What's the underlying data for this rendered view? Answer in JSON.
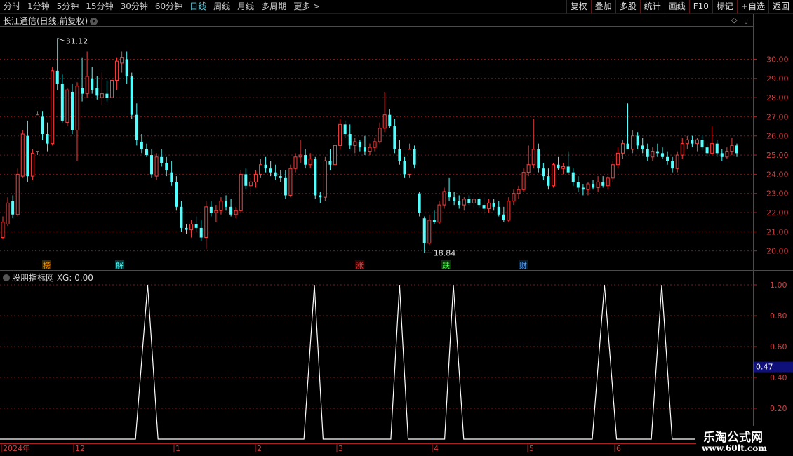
{
  "toolbar": {
    "periods": [
      "分时",
      "1分钟",
      "5分钟",
      "15分钟",
      "30分钟",
      "60分钟",
      "日线",
      "周线",
      "月线",
      "多周期",
      "更多 >"
    ],
    "active_period": "日线",
    "buttons": [
      "复权",
      "叠加",
      "多股",
      "统计",
      "画线",
      "F10",
      "标记",
      "+自选",
      "返回"
    ]
  },
  "stock_title": "长江通信(日线,前复权)",
  "indicator_title": "股朋指标网 XG: 0.00",
  "colors": {
    "up": "#ff3c3c",
    "down": "#54ffff",
    "grid": "#7a1a1a",
    "axis": "#b02020",
    "signal": "#ffffff"
  },
  "price_axis": {
    "min": 19.0,
    "max": 31.7,
    "ticks": [
      "20.00",
      "21.00",
      "22.00",
      "23.00",
      "24.00",
      "25.00",
      "26.00",
      "27.00",
      "28.00",
      "29.00",
      "30.00"
    ]
  },
  "annotations": {
    "high": "31.12",
    "low": "18.84"
  },
  "event_markers": [
    {
      "label": "榜",
      "color": "#ff9900",
      "bg": "#3a2a00"
    },
    {
      "label": "解",
      "color": "#54ffff",
      "bg": "#003a3a"
    },
    {
      "label": "涨",
      "color": "#ff3c3c",
      "bg": "#3a0000"
    },
    {
      "label": "跌",
      "color": "#40ff40",
      "bg": "#003a00"
    },
    {
      "label": "财",
      "color": "#5aa0ff",
      "bg": "#00203a"
    }
  ],
  "indicator_axis": {
    "ticks": [
      "1.00",
      "0.80",
      "0.60",
      "0.40",
      "0.20"
    ],
    "current": "0.47"
  },
  "time_axis": [
    "2024年",
    "12",
    "1",
    "2",
    "3",
    "4",
    "5",
    "6"
  ],
  "watermark": {
    "line1": "乐淘公式网",
    "line2": "www.60lt.com"
  },
  "chart_data": {
    "type": "candlestick",
    "ohlc": [
      [
        20.7,
        21.8,
        20.6,
        21.5
      ],
      [
        21.4,
        22.8,
        21.3,
        22.5
      ],
      [
        22.6,
        22.9,
        21.7,
        21.9
      ],
      [
        21.9,
        24.3,
        21.8,
        24.0
      ],
      [
        23.9,
        26.3,
        23.8,
        26.1
      ],
      [
        26.0,
        26.8,
        23.6,
        23.9
      ],
      [
        23.9,
        25.3,
        23.7,
        25.1
      ],
      [
        25.2,
        27.3,
        25.0,
        27.1
      ],
      [
        27.0,
        27.3,
        25.8,
        26.1
      ],
      [
        26.1,
        26.7,
        25.2,
        25.6
      ],
      [
        25.6,
        29.6,
        25.5,
        29.4
      ],
      [
        29.4,
        31.1,
        28.4,
        28.7
      ],
      [
        28.7,
        29.2,
        26.7,
        26.8
      ],
      [
        26.7,
        28.5,
        26.5,
        28.4
      ],
      [
        28.3,
        28.7,
        26.1,
        26.3
      ],
      [
        26.3,
        28.8,
        24.7,
        28.6
      ],
      [
        28.5,
        30.1,
        27.8,
        28.2
      ],
      [
        28.2,
        30.4,
        28.0,
        29.1
      ],
      [
        29.0,
        29.6,
        28.2,
        28.4
      ],
      [
        28.5,
        29.1,
        27.9,
        28.1
      ],
      [
        28.0,
        29.3,
        27.6,
        28.2
      ],
      [
        28.2,
        28.9,
        27.8,
        28.0
      ],
      [
        28.0,
        29.2,
        27.8,
        28.9
      ],
      [
        28.9,
        30.1,
        28.4,
        29.9
      ],
      [
        29.8,
        30.4,
        29.3,
        30.1
      ],
      [
        30.0,
        30.4,
        28.7,
        29.1
      ],
      [
        29.1,
        29.3,
        26.9,
        27.1
      ],
      [
        27.1,
        27.7,
        25.5,
        25.8
      ],
      [
        25.7,
        26.1,
        25.1,
        25.3
      ],
      [
        25.3,
        25.6,
        24.9,
        25.0
      ],
      [
        25.0,
        25.3,
        23.8,
        24.0
      ],
      [
        23.9,
        25.1,
        23.7,
        24.9
      ],
      [
        24.9,
        25.3,
        24.4,
        24.6
      ],
      [
        24.6,
        24.9,
        23.9,
        24.2
      ],
      [
        24.1,
        24.7,
        23.4,
        23.6
      ],
      [
        23.6,
        23.9,
        22.1,
        22.3
      ],
      [
        22.3,
        22.6,
        21.0,
        21.2
      ],
      [
        21.2,
        21.4,
        20.9,
        21.1
      ],
      [
        21.1,
        21.6,
        20.7,
        21.4
      ],
      [
        21.4,
        21.8,
        21.0,
        21.2
      ],
      [
        21.2,
        21.6,
        20.5,
        20.7
      ],
      [
        20.7,
        22.6,
        20.1,
        22.3
      ],
      [
        22.3,
        22.6,
        21.8,
        22.0
      ],
      [
        22.0,
        22.4,
        21.5,
        22.1
      ],
      [
        22.1,
        22.8,
        21.9,
        22.6
      ],
      [
        22.6,
        22.9,
        22.1,
        22.3
      ],
      [
        22.3,
        22.7,
        21.8,
        21.9
      ],
      [
        21.9,
        22.3,
        21.7,
        22.1
      ],
      [
        22.1,
        24.2,
        22.0,
        24.0
      ],
      [
        24.0,
        24.3,
        23.2,
        23.4
      ],
      [
        23.4,
        23.8,
        22.9,
        23.6
      ],
      [
        23.6,
        24.2,
        23.3,
        24.0
      ],
      [
        24.0,
        24.8,
        23.8,
        24.5
      ],
      [
        24.5,
        24.9,
        24.1,
        24.3
      ],
      [
        24.3,
        24.7,
        23.9,
        24.1
      ],
      [
        24.1,
        24.5,
        23.7,
        23.9
      ],
      [
        23.9,
        24.2,
        23.6,
        23.8
      ],
      [
        23.8,
        24.2,
        22.7,
        22.9
      ],
      [
        22.9,
        24.5,
        22.8,
        24.3
      ],
      [
        24.3,
        25.1,
        24.1,
        24.9
      ],
      [
        24.9,
        25.8,
        24.6,
        25.0
      ],
      [
        25.0,
        25.3,
        24.3,
        24.5
      ],
      [
        24.5,
        25.1,
        24.3,
        24.8
      ],
      [
        24.8,
        24.9,
        22.7,
        22.9
      ],
      [
        22.9,
        23.1,
        22.5,
        22.8
      ],
      [
        22.8,
        24.9,
        22.6,
        24.7
      ],
      [
        24.7,
        25.3,
        24.2,
        24.5
      ],
      [
        24.5,
        25.8,
        24.3,
        25.5
      ],
      [
        25.5,
        26.9,
        25.3,
        26.6
      ],
      [
        26.6,
        26.8,
        25.9,
        26.1
      ],
      [
        26.1,
        26.6,
        25.3,
        25.5
      ],
      [
        25.5,
        25.9,
        25.1,
        25.7
      ],
      [
        25.7,
        25.8,
        25.2,
        25.4
      ],
      [
        25.4,
        26.0,
        25.0,
        25.2
      ],
      [
        25.2,
        25.6,
        25.0,
        25.4
      ],
      [
        25.4,
        25.9,
        25.2,
        25.7
      ],
      [
        25.7,
        26.7,
        25.6,
        26.4
      ],
      [
        26.4,
        28.3,
        26.2,
        27.1
      ],
      [
        27.1,
        27.4,
        26.4,
        26.5
      ],
      [
        26.5,
        26.9,
        25.1,
        25.3
      ],
      [
        25.3,
        25.8,
        24.5,
        24.7
      ],
      [
        24.7,
        24.9,
        23.8,
        24.0
      ],
      [
        24.0,
        25.6,
        23.8,
        25.3
      ],
      [
        25.3,
        25.5,
        24.3,
        24.5
      ],
      [
        23.0,
        23.1,
        21.8,
        22.0
      ],
      [
        21.7,
        21.8,
        19.9,
        20.4
      ],
      [
        20.4,
        21.9,
        20.3,
        21.6
      ],
      [
        21.6,
        22.1,
        21.4,
        21.5
      ],
      [
        21.5,
        22.6,
        21.4,
        22.4
      ],
      [
        22.4,
        23.3,
        22.2,
        23.1
      ],
      [
        23.1,
        23.8,
        22.6,
        22.8
      ],
      [
        22.8,
        23.1,
        22.4,
        22.6
      ],
      [
        22.6,
        22.9,
        22.2,
        22.4
      ],
      [
        22.4,
        22.8,
        22.1,
        22.7
      ],
      [
        22.7,
        22.9,
        22.4,
        22.5
      ],
      [
        22.5,
        22.8,
        22.2,
        22.7
      ],
      [
        22.7,
        22.8,
        22.3,
        22.4
      ],
      [
        22.4,
        22.8,
        21.9,
        22.2
      ],
      [
        22.2,
        22.7,
        22.0,
        22.5
      ],
      [
        22.5,
        22.7,
        22.1,
        22.3
      ],
      [
        22.3,
        22.6,
        21.8,
        21.9
      ],
      [
        21.9,
        22.3,
        21.5,
        21.6
      ],
      [
        21.6,
        22.8,
        21.5,
        22.6
      ],
      [
        22.6,
        23.2,
        22.4,
        23.0
      ],
      [
        23.0,
        23.4,
        22.7,
        23.2
      ],
      [
        23.2,
        24.3,
        23.1,
        24.1
      ],
      [
        24.1,
        25.5,
        23.9,
        24.5
      ],
      [
        24.5,
        26.9,
        24.3,
        25.3
      ],
      [
        25.3,
        25.6,
        24.1,
        24.3
      ],
      [
        24.3,
        24.6,
        23.7,
        23.9
      ],
      [
        23.9,
        24.3,
        23.2,
        23.4
      ],
      [
        23.4,
        24.6,
        23.3,
        24.5
      ],
      [
        24.5,
        24.9,
        24.2,
        24.3
      ],
      [
        24.3,
        24.6,
        24.0,
        24.4
      ],
      [
        24.4,
        25.2,
        24.0,
        24.1
      ],
      [
        24.1,
        24.3,
        23.4,
        23.6
      ],
      [
        23.6,
        23.9,
        23.1,
        23.3
      ],
      [
        23.3,
        23.5,
        22.9,
        23.2
      ],
      [
        23.2,
        23.6,
        22.9,
        23.5
      ],
      [
        23.5,
        23.7,
        23.2,
        23.3
      ],
      [
        23.3,
        23.9,
        23.1,
        23.6
      ],
      [
        23.6,
        23.9,
        23.3,
        23.4
      ],
      [
        23.4,
        23.9,
        23.2,
        23.8
      ],
      [
        23.8,
        24.7,
        23.6,
        24.5
      ],
      [
        24.5,
        25.4,
        24.3,
        25.1
      ],
      [
        25.1,
        25.8,
        24.8,
        25.6
      ],
      [
        25.6,
        27.7,
        25.4,
        25.3
      ],
      [
        25.3,
        26.3,
        25.1,
        26.0
      ],
      [
        26.0,
        26.2,
        25.3,
        25.5
      ],
      [
        25.5,
        25.9,
        25.1,
        25.3
      ],
      [
        25.3,
        25.6,
        24.7,
        24.9
      ],
      [
        24.9,
        25.4,
        24.7,
        25.2
      ],
      [
        25.2,
        25.6,
        24.9,
        25.1
      ],
      [
        25.1,
        25.4,
        24.8,
        24.9
      ],
      [
        24.9,
        25.2,
        24.5,
        24.7
      ],
      [
        24.7,
        24.9,
        24.1,
        24.3
      ],
      [
        24.3,
        25.2,
        24.1,
        25.0
      ],
      [
        25.0,
        25.9,
        24.8,
        25.6
      ],
      [
        25.6,
        26.0,
        25.3,
        25.8
      ],
      [
        25.8,
        26.0,
        25.4,
        25.6
      ],
      [
        25.6,
        25.9,
        25.2,
        25.8
      ],
      [
        25.8,
        26.0,
        25.3,
        25.4
      ],
      [
        25.4,
        25.6,
        24.9,
        25.1
      ],
      [
        25.1,
        26.5,
        25.0,
        25.6
      ],
      [
        25.6,
        25.8,
        24.9,
        25.1
      ],
      [
        25.1,
        25.3,
        24.7,
        24.9
      ],
      [
        24.9,
        25.4,
        24.8,
        25.2
      ],
      [
        25.2,
        25.9,
        25.0,
        25.5
      ],
      [
        25.5,
        25.6,
        24.9,
        25.1
      ]
    ],
    "xg_signal": [
      [
        0,
        0
      ],
      [
        78,
        0
      ],
      [
        85,
        1
      ],
      [
        91,
        0
      ],
      [
        175,
        0
      ],
      [
        181,
        1
      ],
      [
        186,
        0
      ],
      [
        225,
        0
      ],
      [
        230,
        1
      ],
      [
        235,
        0
      ],
      [
        256,
        0
      ],
      [
        261,
        1
      ],
      [
        267,
        0
      ],
      [
        341,
        0
      ],
      [
        348,
        1
      ],
      [
        355,
        0
      ],
      [
        375,
        0
      ],
      [
        381,
        1
      ],
      [
        387,
        0
      ],
      [
        400,
        0
      ]
    ]
  }
}
